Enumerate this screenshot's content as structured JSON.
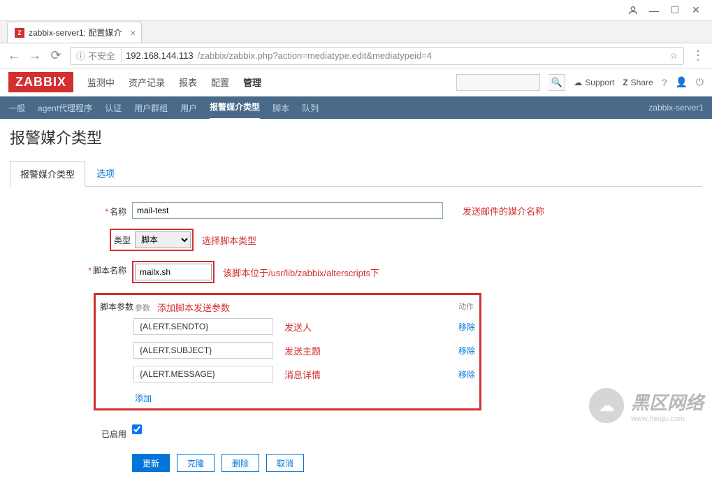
{
  "browser": {
    "tab_title": "zabbix-server1: 配置媒介",
    "url_warning": "不安全",
    "url_host": "192.168.144.113",
    "url_path": "/zabbix/zabbix.php?action=mediatype.edit&mediatypeid=4"
  },
  "header": {
    "logo": "ZABBIX",
    "nav": [
      "监测中",
      "资产记录",
      "报表",
      "配置",
      "管理"
    ],
    "active_nav": "管理",
    "support": "Support",
    "share": "Share"
  },
  "subnav": {
    "items": [
      "一般",
      "agent代理程序",
      "认证",
      "用户群组",
      "用户",
      "报警媒介类型",
      "脚本",
      "队列"
    ],
    "active": "报警媒介类型",
    "server_name": "zabbix-server1"
  },
  "page": {
    "title": "报警媒介类型",
    "tabs": [
      "报警媒介类型",
      "选项"
    ],
    "active_tab": "报警媒介类型"
  },
  "form": {
    "name_label": "名称",
    "name_value": "mail-test",
    "name_anno": "发送邮件的媒介名称",
    "type_label": "类型",
    "type_value": "脚本",
    "type_anno": "选择脚本类型",
    "script_label": "脚本名称",
    "script_value": "mailx.sh",
    "script_anno": "该脚本位于/usr/lib/zabbix/alterscripts下",
    "params_label": "脚本参数",
    "params_hdr_left": "参数",
    "params_hdr_anno": "添加脚本发送参数",
    "params_hdr_right": "动作",
    "params": [
      {
        "value": "{ALERT.SENDTO}",
        "anno": "发送人"
      },
      {
        "value": "{ALERT.SUBJECT}",
        "anno": "发送主题"
      },
      {
        "value": "{ALERT.MESSAGE}",
        "anno": "消息详情"
      }
    ],
    "remove_label": "移除",
    "add_label": "添加",
    "enabled_label": "已启用"
  },
  "buttons": {
    "update": "更新",
    "clone": "克隆",
    "delete": "删除",
    "cancel": "取消"
  },
  "watermark": {
    "brand": "黑区网络",
    "domain": "www.heiqu.com"
  }
}
